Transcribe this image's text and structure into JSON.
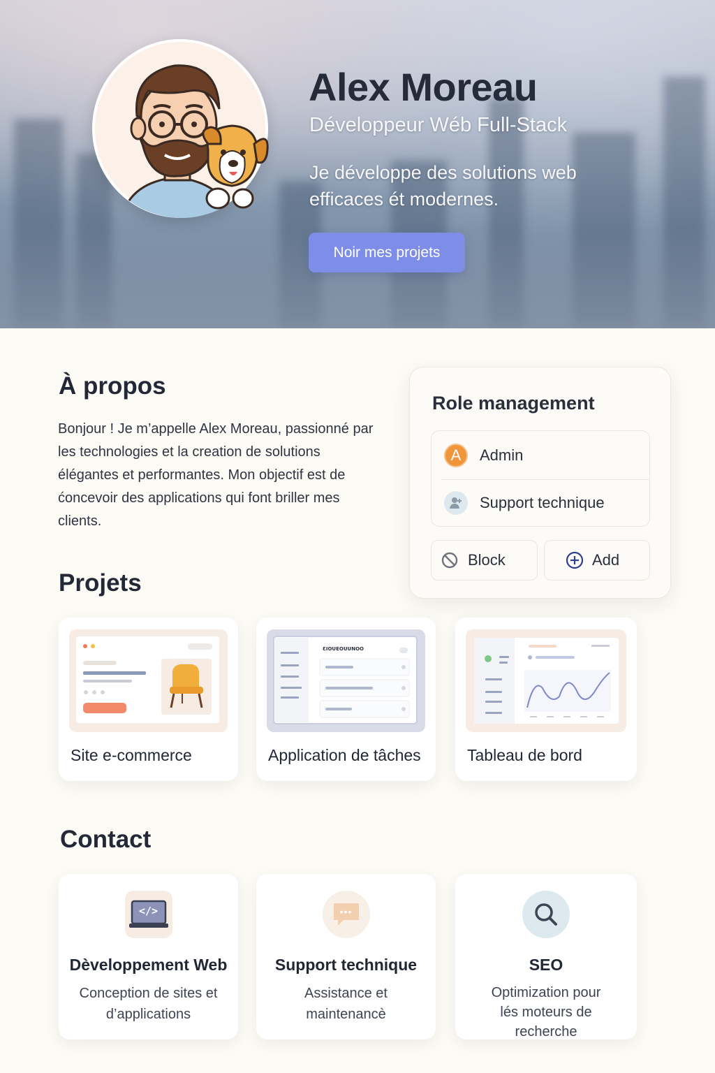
{
  "hero": {
    "name": "Alex Moreau",
    "role": "Développeur Wéb Full-Stack",
    "tagline": "Je développe des solutions web efficaces ét modernes.",
    "cta_label": "Noir mes projets"
  },
  "about": {
    "heading": "À propos",
    "text": "Bonjour ! Je m’appelle Alex Moreau, passionné par les technologies et la creation de solutions élégantes et performantes. Mon objectif est de ćoncevoir des applications qui font briller mes clients."
  },
  "role_management": {
    "title": "Role management",
    "roles": [
      {
        "label": "Admin",
        "icon": "admin-letter-icon",
        "icon_text": "A"
      },
      {
        "label": "Support technique",
        "icon": "user-support-icon"
      }
    ],
    "block_label": "Block",
    "add_label": "Add"
  },
  "projects": {
    "heading": "Projets",
    "items": [
      {
        "title": "Site e-commerce",
        "thumb": "ecommerce-chair-preview"
      },
      {
        "title": "Application de tâches",
        "thumb": "task-app-preview",
        "thumb_text": "ƐIOUEOUUNOO"
      },
      {
        "title": "Tableau de bord",
        "thumb": "dashboard-chart-preview"
      }
    ]
  },
  "contact": {
    "heading": "Contact",
    "items": [
      {
        "title": "Dèveloppement Web",
        "desc": "Conception de sites et d’applications",
        "icon": "laptop-code-icon",
        "icon_text": "</>"
      },
      {
        "title": "Support technique",
        "desc": "Assistance et maintenancè",
        "icon": "chat-bubble-icon",
        "icon_text": "•••"
      },
      {
        "title": "SEO",
        "desc": "Optimization pour lés moteurs  de recherche",
        "icon": "magnifier-icon"
      }
    ]
  },
  "colors": {
    "accent": "#7e8ee8",
    "admin_badge": "#f0953a",
    "background": "#fdfbf6"
  }
}
